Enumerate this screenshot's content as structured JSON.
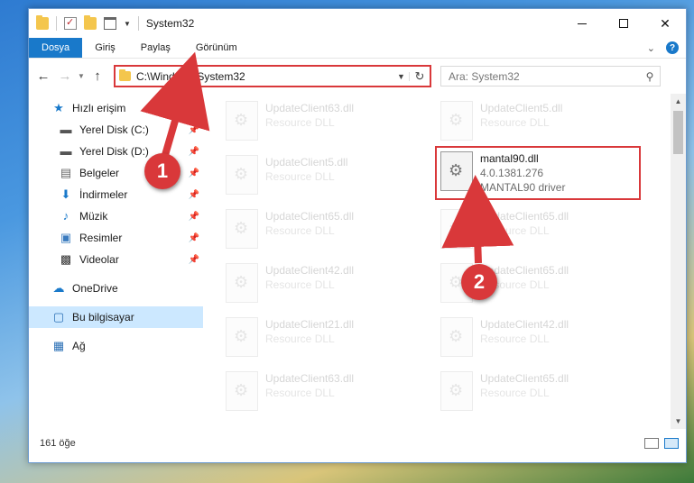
{
  "window": {
    "title": "System32"
  },
  "ribbon": {
    "tabs": [
      "Dosya",
      "Giriş",
      "Paylaş",
      "Görünüm"
    ]
  },
  "address": {
    "path": "C:\\Windows\\System32",
    "search_placeholder": "Ara: System32"
  },
  "sidebar": {
    "items": [
      {
        "label": "Hızlı erişim",
        "icon": "star-icon",
        "pinned": false
      },
      {
        "label": "Yerel Disk (C:)",
        "icon": "drive-icon",
        "pinned": true
      },
      {
        "label": "Yerel Disk (D:)",
        "icon": "drive-icon",
        "pinned": true
      },
      {
        "label": "Belgeler",
        "icon": "document-icon",
        "pinned": true
      },
      {
        "label": "İndirmeler",
        "icon": "download-icon",
        "pinned": true
      },
      {
        "label": "Müzik",
        "icon": "music-icon",
        "pinned": true
      },
      {
        "label": "Resimler",
        "icon": "pictures-icon",
        "pinned": true
      },
      {
        "label": "Videolar",
        "icon": "video-icon",
        "pinned": true
      },
      {
        "label": "OneDrive",
        "icon": "cloud-icon",
        "pinned": false
      },
      {
        "label": "Bu bilgisayar",
        "icon": "computer-icon",
        "pinned": false
      },
      {
        "label": "Ağ",
        "icon": "network-icon",
        "pinned": false
      }
    ]
  },
  "files": {
    "col1": [
      {
        "name": "UpdateClient63.dll",
        "desc": "Resource DLL"
      },
      {
        "name": "UpdateClient5.dll",
        "desc": "Resource DLL"
      },
      {
        "name": "UpdateClient65.dll",
        "desc": "Resource DLL"
      },
      {
        "name": "UpdateClient42.dll",
        "desc": "Resource DLL"
      },
      {
        "name": "UpdateClient21.dll",
        "desc": "Resource DLL"
      },
      {
        "name": "UpdateClient63.dll",
        "desc": "Resource DLL"
      }
    ],
    "col2": [
      {
        "name": "UpdateClient5.dll",
        "desc": "Resource DLL"
      },
      {
        "name": "UpdateClient65.dll",
        "desc": "Resource DLL"
      },
      {
        "name": "UpdateClient65.dll",
        "desc": "Resource DLL"
      },
      {
        "name": "UpdateClient42.dll",
        "desc": "Resource DLL"
      },
      {
        "name": "UpdateClient65.dll",
        "desc": "Resource DLL"
      }
    ],
    "highlighted": {
      "name": "mantal90.dll",
      "version": "4.0.1381.276",
      "desc": "MANTAL90 driver"
    }
  },
  "status": {
    "count": "161 öğe"
  },
  "annotations": {
    "badge1": "1",
    "badge2": "2"
  },
  "colors": {
    "accent": "#1979ca",
    "highlight": "#d9383a"
  }
}
